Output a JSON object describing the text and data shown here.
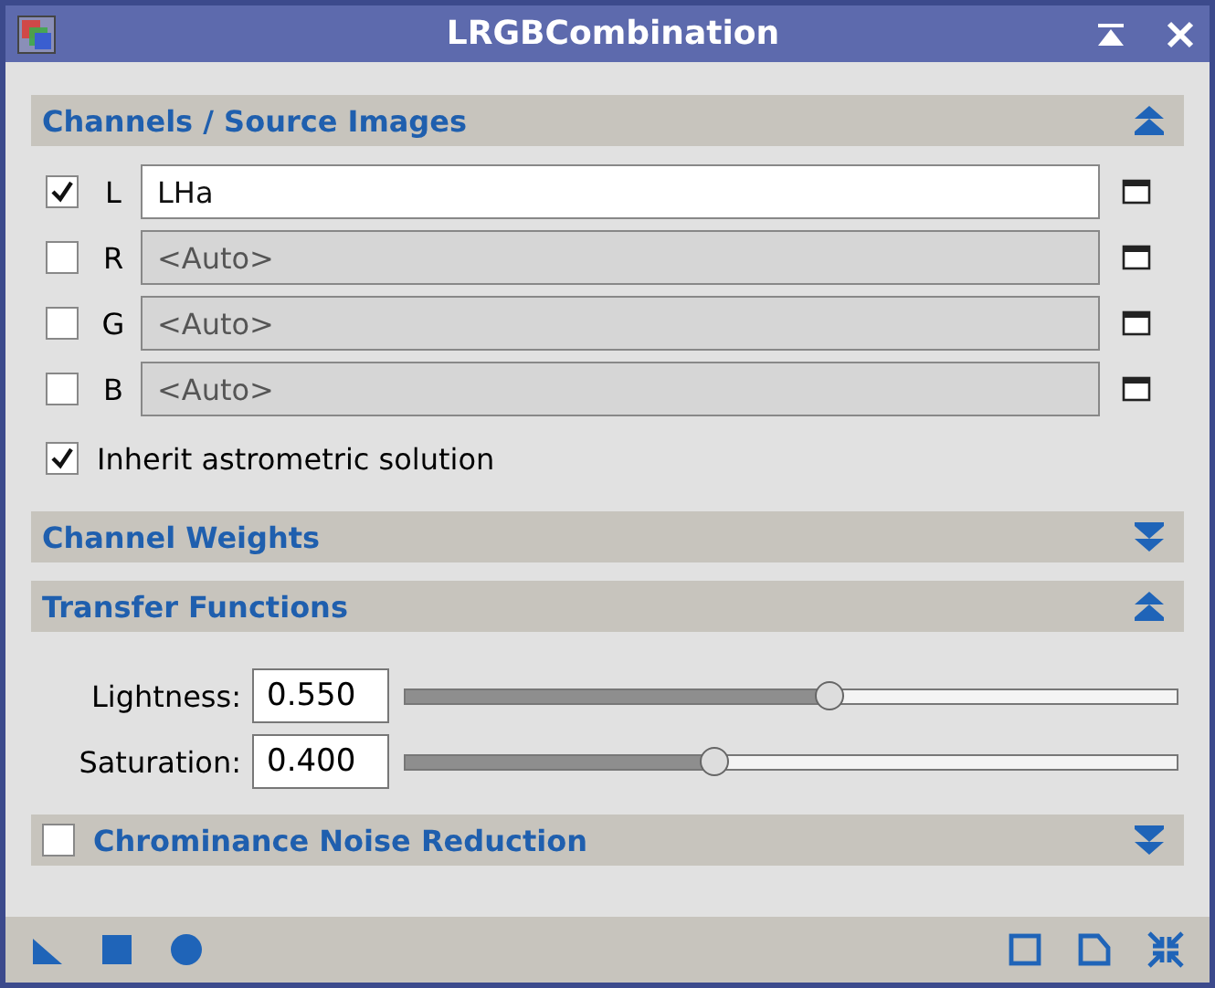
{
  "window": {
    "title": "LRGBCombination"
  },
  "sections": [
    {
      "kind": "channels",
      "title": "Channels / Source Images",
      "expanded": true,
      "channels": [
        {
          "label": "L",
          "checked": true,
          "value": "LHa"
        },
        {
          "label": "R",
          "checked": false,
          "placeholder": "<Auto>"
        },
        {
          "label": "G",
          "checked": false,
          "placeholder": "<Auto>"
        },
        {
          "label": "B",
          "checked": false,
          "placeholder": "<Auto>"
        }
      ],
      "inherit": {
        "label": "Inherit astrometric solution",
        "checked": true
      }
    },
    {
      "kind": "plain",
      "title": "Channel Weights",
      "expanded": false
    },
    {
      "kind": "sliders",
      "title": "Transfer Functions",
      "expanded": true,
      "sliders": [
        {
          "label": "Lightness:",
          "value": "0.550",
          "level": 0.55
        },
        {
          "label": "Saturation:",
          "value": "0.400",
          "level": 0.4
        }
      ]
    },
    {
      "kind": "checkable",
      "title": "Chrominance Noise Reduction",
      "expanded": false,
      "checked": false
    }
  ]
}
